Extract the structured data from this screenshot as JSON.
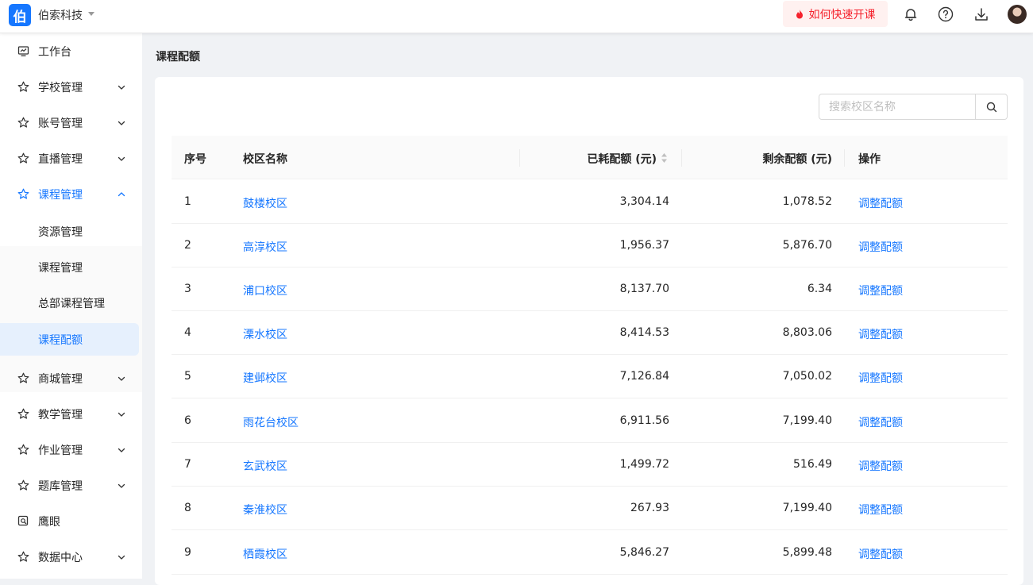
{
  "header": {
    "logo_char": "伯",
    "org_name": "伯索科技",
    "quick_start": "如何快速开课"
  },
  "sidebar": {
    "items": [
      {
        "label": "工作台"
      },
      {
        "label": "学校管理"
      },
      {
        "label": "账号管理"
      },
      {
        "label": "直播管理"
      },
      {
        "label": "课程管理"
      },
      {
        "label": "商城管理"
      },
      {
        "label": "教学管理"
      },
      {
        "label": "作业管理"
      },
      {
        "label": "题库管理"
      },
      {
        "label": "鹰眼"
      },
      {
        "label": "数据中心"
      }
    ],
    "subitems": [
      {
        "label": "资源管理"
      },
      {
        "label": "课程管理"
      },
      {
        "label": "总部课程管理"
      },
      {
        "label": "课程配额"
      }
    ]
  },
  "main": {
    "title": "课程配额",
    "search_placeholder": "搜索校区名称",
    "columns": {
      "index": "序号",
      "campus": "校区名称",
      "used": "已耗配额 (元)",
      "remaining": "剩余配额 (元)",
      "action": "操作"
    },
    "rows": [
      {
        "index": "1",
        "campus": "鼓楼校区",
        "used": "3,304.14",
        "remaining": "1,078.52",
        "action": "调整配额"
      },
      {
        "index": "2",
        "campus": "高淳校区",
        "used": "1,956.37",
        "remaining": "5,876.70",
        "action": "调整配额"
      },
      {
        "index": "3",
        "campus": "浦口校区",
        "used": "8,137.70",
        "remaining": "6.34",
        "action": "调整配额"
      },
      {
        "index": "4",
        "campus": "溧水校区",
        "used": "8,414.53",
        "remaining": "8,803.06",
        "action": "调整配额"
      },
      {
        "index": "5",
        "campus": "建邺校区",
        "used": "7,126.84",
        "remaining": "7,050.02",
        "action": "调整配额"
      },
      {
        "index": "6",
        "campus": "雨花台校区",
        "used": "6,911.56",
        "remaining": "7,199.40",
        "action": "调整配额"
      },
      {
        "index": "7",
        "campus": "玄武校区",
        "used": "1,499.72",
        "remaining": "516.49",
        "action": "调整配额"
      },
      {
        "index": "8",
        "campus": "秦淮校区",
        "used": "267.93",
        "remaining": "7,199.40",
        "action": "调整配额"
      },
      {
        "index": "9",
        "campus": "栖霞校区",
        "used": "5,846.27",
        "remaining": "5,899.48",
        "action": "调整配额"
      }
    ]
  },
  "colors": {
    "accent": "#1677ff",
    "danger": "#f5222d",
    "danger_bg": "#fff1f0",
    "selected_bg": "#e6f0fd"
  }
}
